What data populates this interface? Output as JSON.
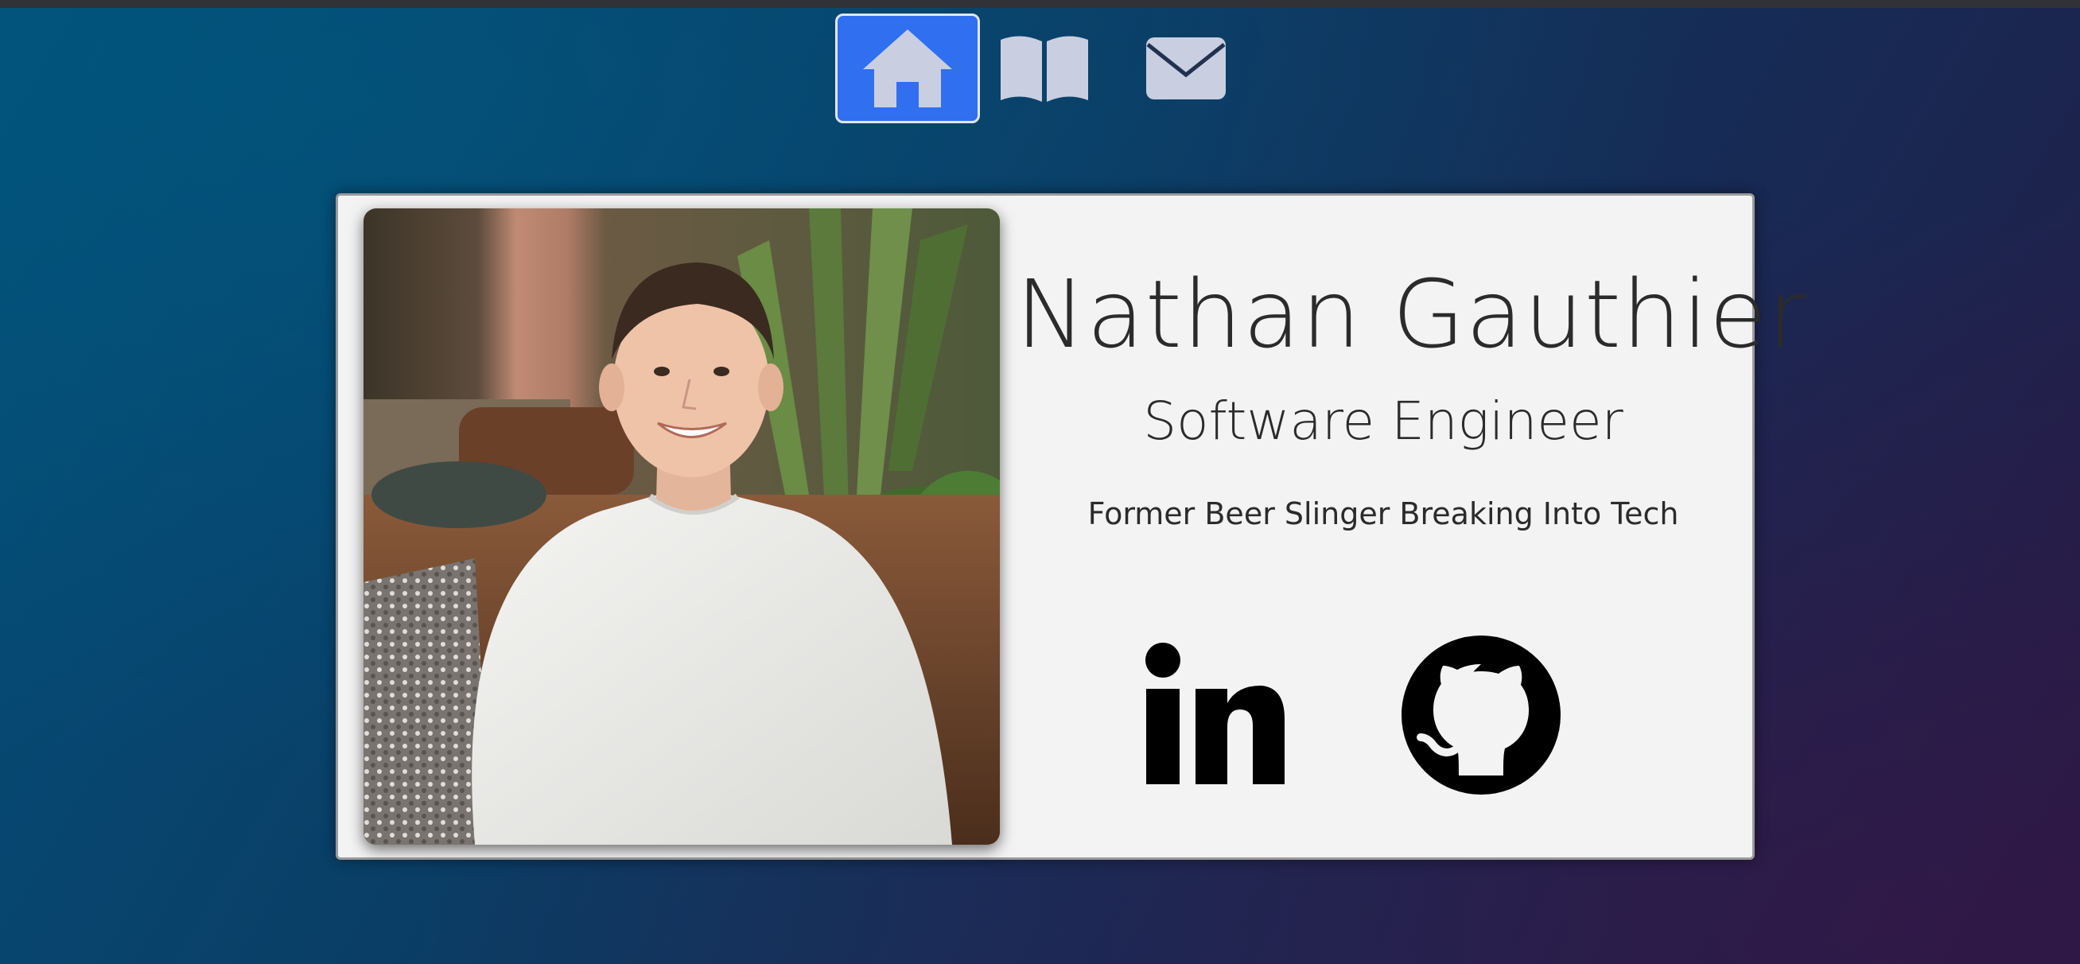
{
  "nav": {
    "items": [
      {
        "icon": "home-icon",
        "active": true
      },
      {
        "icon": "book-icon",
        "active": false
      },
      {
        "icon": "envelope-icon",
        "active": false
      }
    ]
  },
  "profile": {
    "name": "Nathan Gauthier",
    "title": "Software Engineer",
    "tagline": "Former Beer Slinger Breaking Into Tech"
  },
  "social": {
    "items": [
      {
        "icon": "linkedin-icon",
        "text": "in"
      },
      {
        "icon": "github-icon"
      }
    ]
  },
  "colors": {
    "nav_active": "#2f6ff0",
    "nav_icon": "#c9cfe0",
    "card_background": "#f3f3f3",
    "text": "#2b2b2b"
  }
}
